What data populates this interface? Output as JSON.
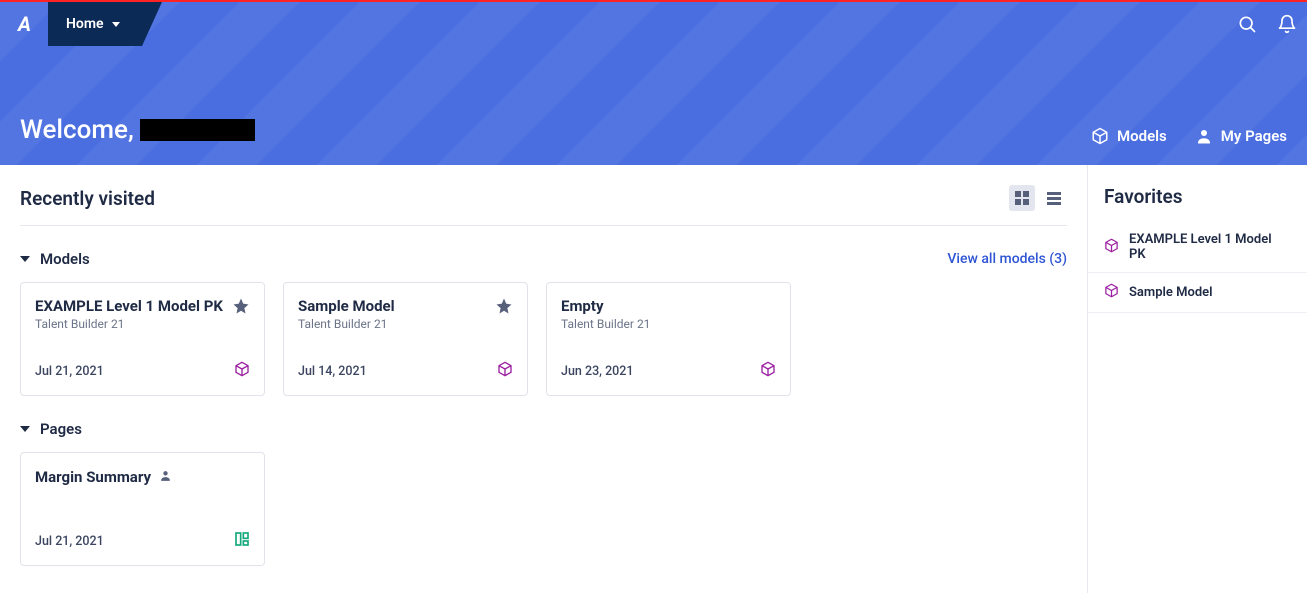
{
  "nav": {
    "home_label": "Home"
  },
  "hero": {
    "welcome_prefix": "Welcome,",
    "models_link": "Models",
    "mypages_link": "My Pages"
  },
  "recently_visited_title": "Recently visited",
  "sections": {
    "models": {
      "label": "Models",
      "view_all": "View all models (3)",
      "cards": [
        {
          "title": "EXAMPLE Level 1 Model PK",
          "subtitle": "Talent Builder 21",
          "date": "Jul 21, 2021",
          "fav": true
        },
        {
          "title": "Sample Model",
          "subtitle": "Talent Builder 21",
          "date": "Jul 14, 2021",
          "fav": true
        },
        {
          "title": "Empty",
          "subtitle": "Talent Builder 21",
          "date": "Jun 23, 2021",
          "fav": false
        }
      ]
    },
    "pages": {
      "label": "Pages",
      "cards": [
        {
          "title": "Margin Summary",
          "subtitle": "",
          "date": "Jul 21, 2021"
        }
      ]
    }
  },
  "favorites": {
    "title": "Favorites",
    "items": [
      {
        "label": "EXAMPLE Level 1 Model PK"
      },
      {
        "label": "Sample Model"
      }
    ]
  }
}
